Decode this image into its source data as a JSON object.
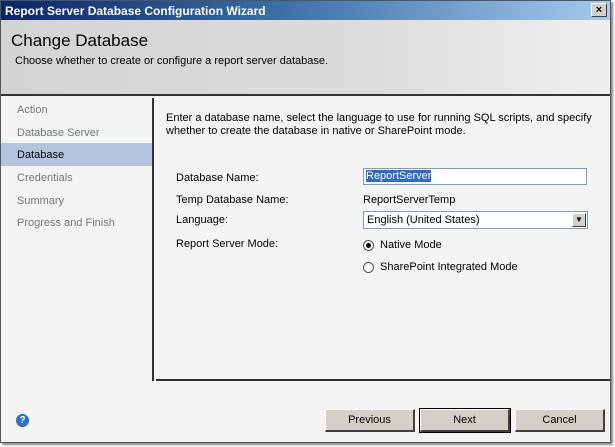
{
  "window": {
    "title": "Report Server Database Configuration Wizard",
    "close": "✕"
  },
  "header": {
    "title": "Change Database",
    "subtitle": "Choose whether to create or configure a report server database."
  },
  "sidebar": {
    "items": [
      {
        "label": "Action"
      },
      {
        "label": "Database Server"
      },
      {
        "label": "Database",
        "selected": true
      },
      {
        "label": "Credentials"
      },
      {
        "label": "Summary"
      },
      {
        "label": "Progress and Finish"
      }
    ]
  },
  "main": {
    "intro": "Enter a database name, select the language to use for running SQL scripts, and specify whether to create the database in native or SharePoint mode.",
    "db_name_label": "Database Name:",
    "db_name_value": "ReportServer",
    "temp_db_label": "Temp Database Name:",
    "temp_db_value": "ReportServerTemp",
    "language_label": "Language:",
    "language_value": "English (United States)",
    "mode_label": "Report Server Mode:",
    "mode_native": "Native Mode",
    "mode_sharepoint": "SharePoint Integrated Mode"
  },
  "footer": {
    "help": "?",
    "previous": "Previous",
    "next": "Next",
    "cancel": "Cancel"
  }
}
